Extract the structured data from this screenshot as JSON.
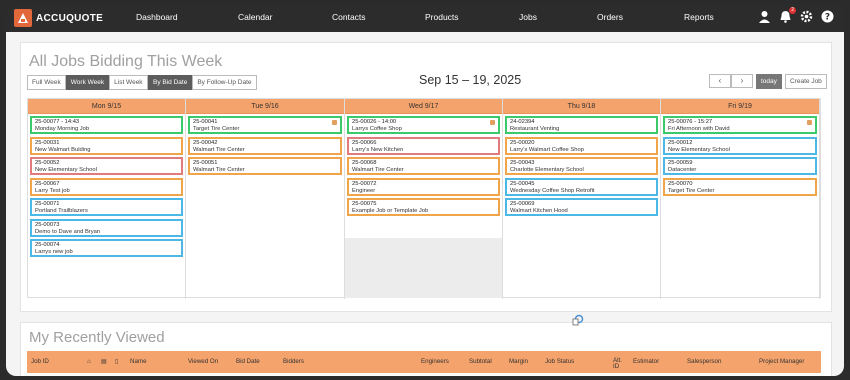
{
  "brand": {
    "name": "ACCUQUOTE",
    "color": "#e2683c"
  },
  "nav": {
    "items": [
      "Dashboard",
      "Calendar",
      "Contacts",
      "Products",
      "Jobs",
      "Orders",
      "Reports"
    ],
    "badge_count": "2",
    "icons": [
      "user-icon",
      "bell-icon",
      "gear-icon",
      "help-icon"
    ]
  },
  "bidding": {
    "title": "All Jobs Bidding This Week",
    "view_buttons": [
      "Full Week",
      "Work Week",
      "List Week"
    ],
    "view_active": "Work Week",
    "sort_buttons": [
      "By Bid Date",
      "By Follow-Up Date"
    ],
    "sort_active": "By Bid Date",
    "date_range": "Sep 15 – 19, 2025",
    "prev_label": "‹",
    "next_label": "›",
    "today_label": "today",
    "create_label": "Create Job",
    "days": [
      {
        "label": "Mon 9/15",
        "jobs": [
          {
            "id": "25-00077 - 14:43",
            "name": "Monday Morning Job",
            "color": "green"
          },
          {
            "id": "25-00031",
            "name": "New Walmart Bulding",
            "color": "orange"
          },
          {
            "id": "25-00052",
            "name": "New Elementary School",
            "color": "red"
          },
          {
            "id": "25-00067",
            "name": "Larry Test job",
            "color": "orange"
          },
          {
            "id": "25-00071",
            "name": "Portland Trailblazers",
            "color": "blue"
          },
          {
            "id": "25-00073",
            "name": "Demo to Dave and Bryan",
            "color": "blue"
          },
          {
            "id": "25-00074",
            "name": "Larrys new job",
            "color": "blue"
          }
        ]
      },
      {
        "label": "Tue 9/16",
        "jobs": [
          {
            "id": "25-00041",
            "name": "Target Tire Center",
            "color": "green",
            "flag": true
          },
          {
            "id": "25-00042",
            "name": "Walmart Tire Center",
            "color": "orange"
          },
          {
            "id": "25-00051",
            "name": "Walmart Tire Center",
            "color": "orange"
          }
        ]
      },
      {
        "label": "Wed 9/17",
        "jobs": [
          {
            "id": "25-00026 - 14:00",
            "name": "Larrys Coffee Shop",
            "color": "green",
            "flag": true
          },
          {
            "id": "25-00066",
            "name": "Larry's New Kitchen",
            "color": "red"
          },
          {
            "id": "25-00068",
            "name": "Walmart Tire Center",
            "color": "orange"
          },
          {
            "id": "25-00072",
            "name": "Engineer",
            "color": "orange"
          },
          {
            "id": "25-00075",
            "name": "Example Job or Template Job",
            "color": "orange"
          }
        ]
      },
      {
        "label": "Thu 9/18",
        "jobs": [
          {
            "id": "24-02394",
            "name": "Restaurant Venting",
            "color": "green"
          },
          {
            "id": "25-00020",
            "name": "Larry's Walmart Coffee Shop",
            "color": "orange"
          },
          {
            "id": "25-00043",
            "name": "Charlotte Elementary School",
            "color": "orange"
          },
          {
            "id": "25-00045",
            "name": "Wednesday Coffee Shop Retrofit",
            "color": "blue"
          },
          {
            "id": "25-00069",
            "name": "Walmart Kitchen Hood",
            "color": "blue"
          }
        ]
      },
      {
        "label": "Fri 9/19",
        "jobs": [
          {
            "id": "25-00076 - 15:27",
            "name": "Fri Afternoon with David",
            "color": "green",
            "flag": true
          },
          {
            "id": "25-00012",
            "name": "New Elementary School",
            "color": "blue"
          },
          {
            "id": "25-00059",
            "name": "Datacenter",
            "color": "blue"
          },
          {
            "id": "25-00070",
            "name": "Target Tire Center",
            "color": "orange"
          }
        ]
      }
    ]
  },
  "recent": {
    "title": "My Recently Viewed",
    "columns": [
      "Job ID",
      "Name",
      "Viewed On",
      "Bid Date",
      "Bidders",
      "Engineers",
      "Subtotal",
      "Margin",
      "Job Status",
      "Alt. ID",
      "Estimator",
      "Salesperson",
      "Project Manager"
    ]
  }
}
